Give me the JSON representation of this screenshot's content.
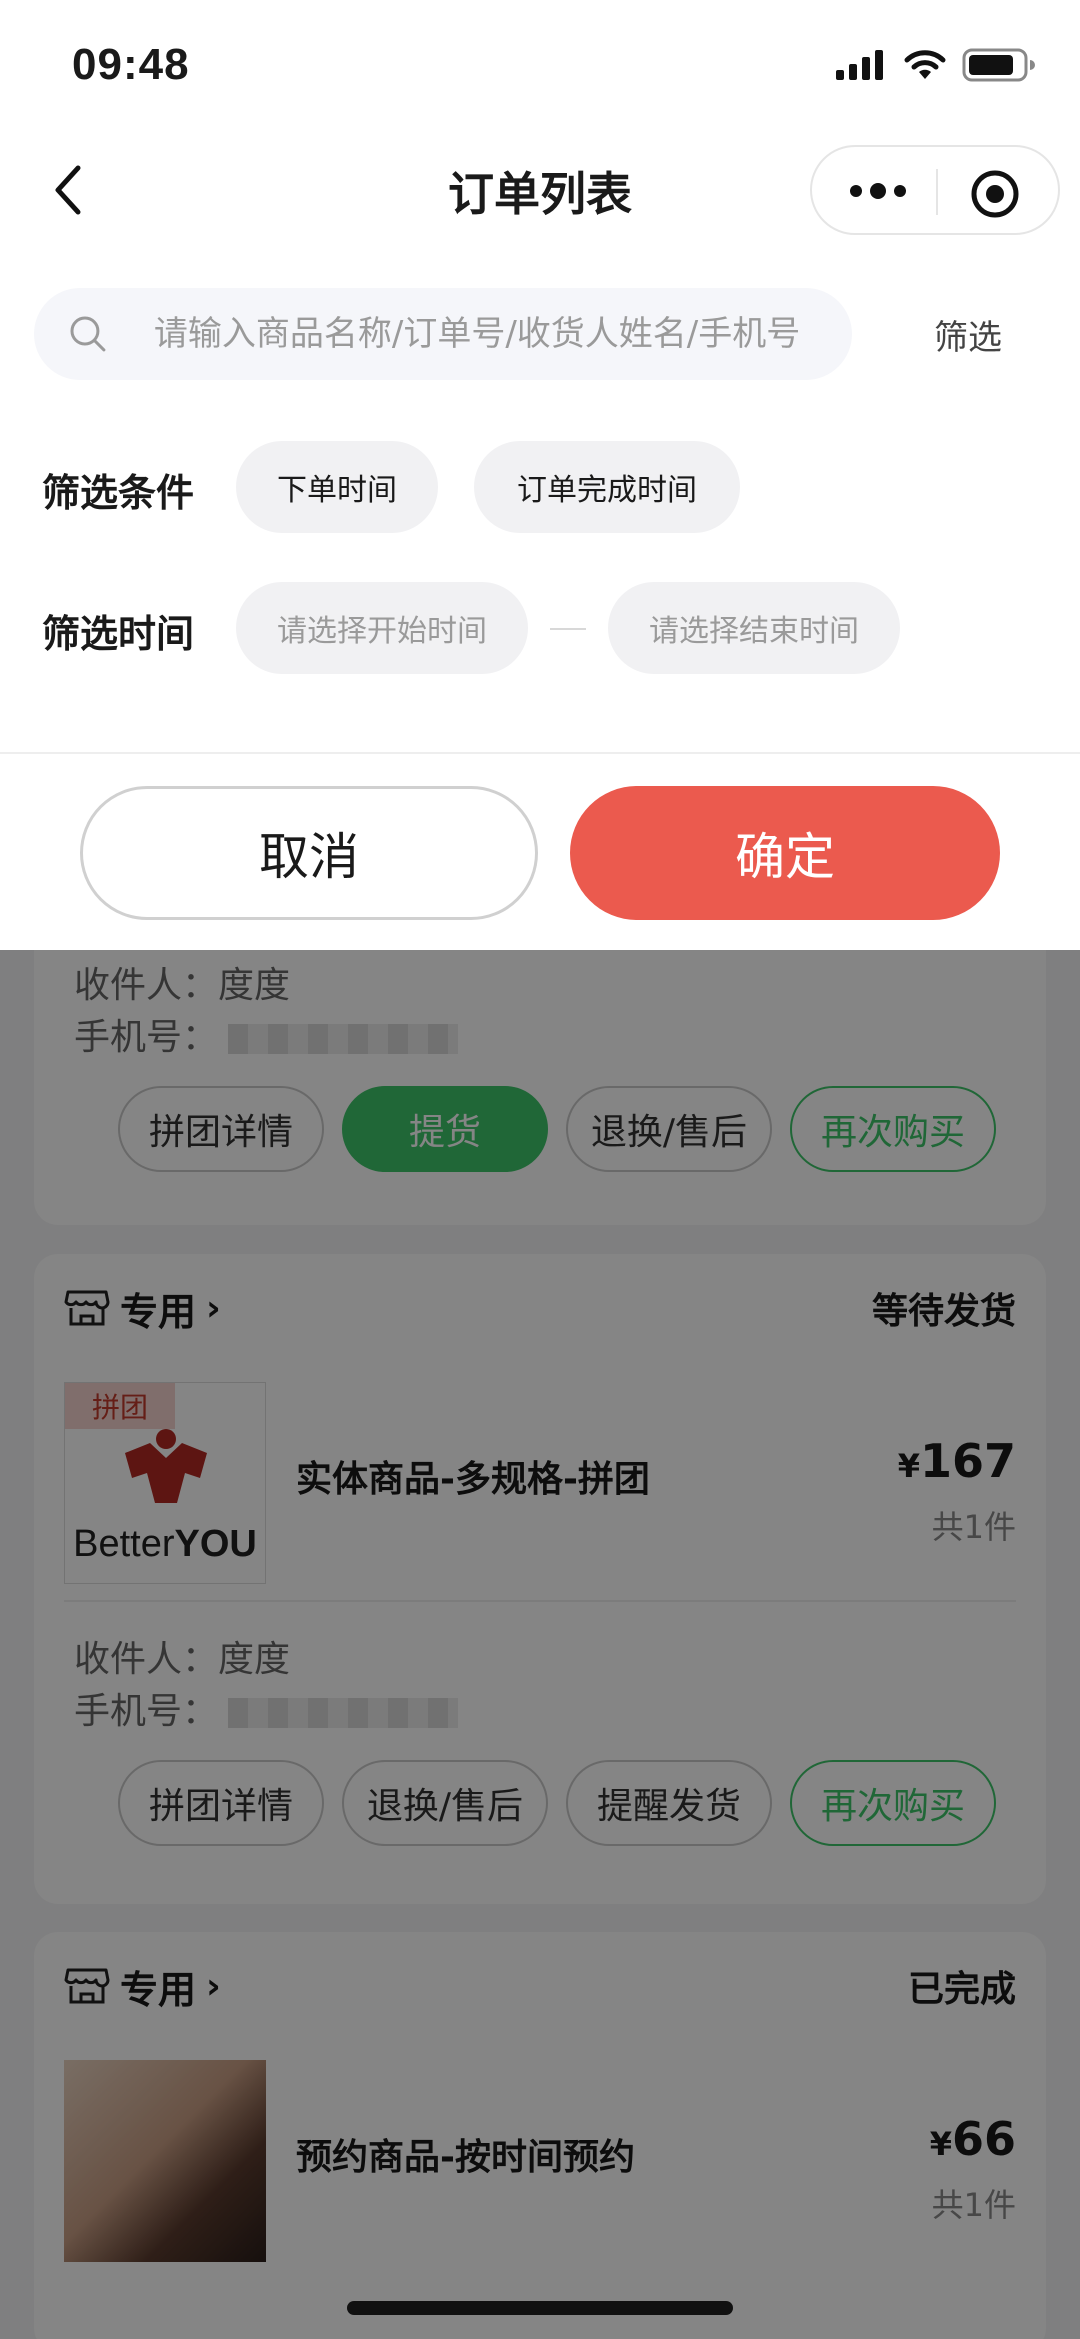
{
  "status_bar": {
    "time": "09:48"
  },
  "nav": {
    "title": "订单列表"
  },
  "search": {
    "placeholder": "请输入商品名称/订单号/收货人姓名/手机号",
    "filter_label": "筛选"
  },
  "filter": {
    "condition_label": "筛选条件",
    "conditions": [
      "下单时间",
      "订单完成时间"
    ],
    "time_label": "筛选时间",
    "start_placeholder": "请选择开始时间",
    "end_placeholder": "请选择结束时间"
  },
  "actions": {
    "cancel": "取消",
    "confirm": "确定"
  },
  "orders": [
    {
      "receiver_label": "收件人：",
      "receiver": "度度",
      "phone_label": "手机号：",
      "buttons": [
        "拼团详情",
        "提货",
        "退换/售后",
        "再次购买"
      ]
    },
    {
      "shop": "专用",
      "status": "等待发货",
      "badge": "拼团",
      "logo_text_a": "Better",
      "logo_text_b": "YOU",
      "goods_name": "实体商品-多规格-拼团",
      "currency": "¥",
      "price": "167",
      "qty": "共1件",
      "receiver_label": "收件人：",
      "receiver": "度度",
      "phone_label": "手机号：",
      "buttons": [
        "拼团详情",
        "退换/售后",
        "提醒发货",
        "再次购买"
      ]
    },
    {
      "shop": "专用",
      "status": "已完成",
      "goods_name": "预约商品-按时间预约",
      "currency": "¥",
      "price": "66",
      "qty": "共1件"
    }
  ]
}
